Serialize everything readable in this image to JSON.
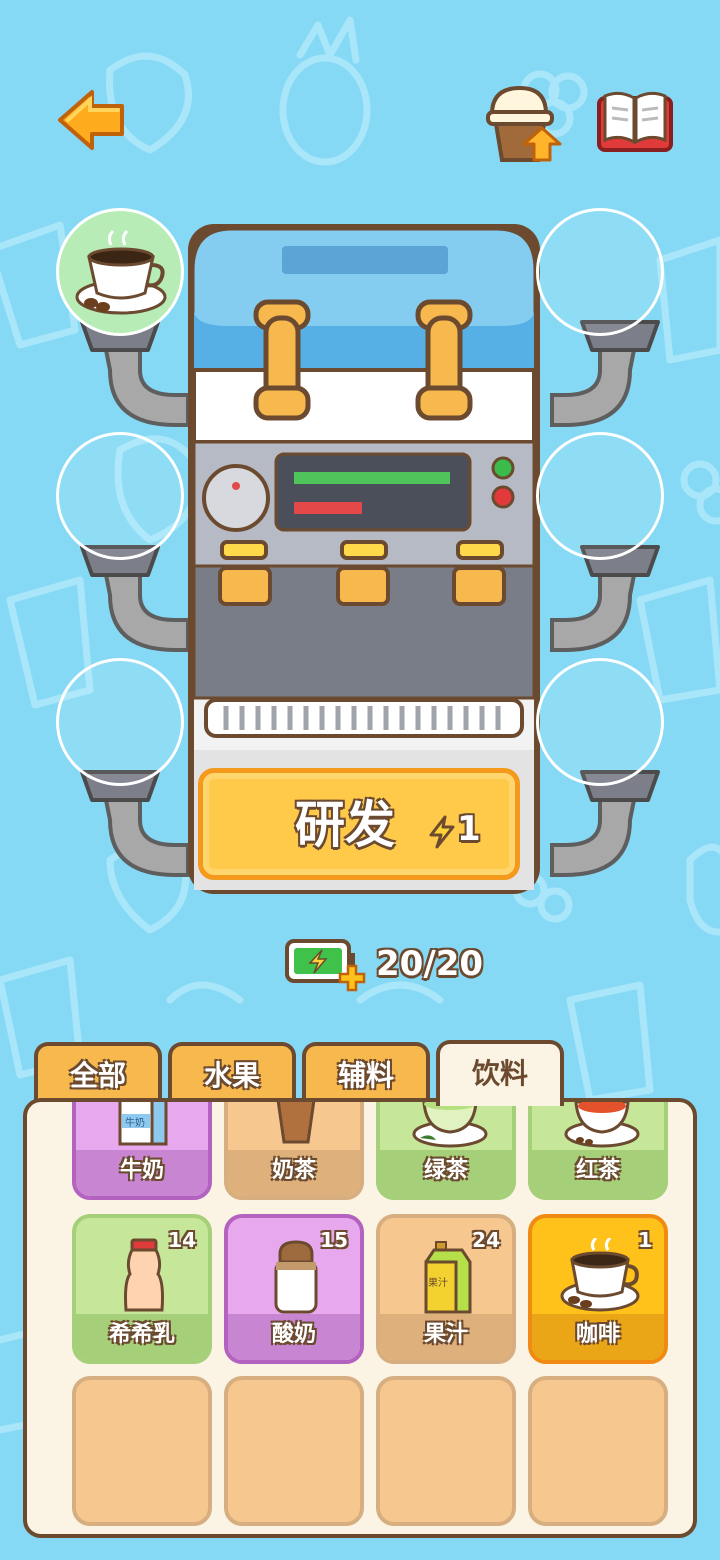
{
  "energy": {
    "value": "20/20"
  },
  "machine": {
    "button_label": "研发",
    "cost": "1"
  },
  "tabs": [
    {
      "label": "全部",
      "active": false
    },
    {
      "label": "水果",
      "active": false
    },
    {
      "label": "辅料",
      "active": false
    },
    {
      "label": "饮料",
      "active": true
    }
  ],
  "items_row1": [
    {
      "name": "牛奶",
      "color": "purple"
    },
    {
      "name": "奶茶",
      "color": "tan"
    },
    {
      "name": "绿茶",
      "color": "green"
    },
    {
      "name": "红茶",
      "color": "green"
    }
  ],
  "items_row2": [
    {
      "name": "希希乳",
      "count": "14",
      "color": "green"
    },
    {
      "name": "酸奶",
      "count": "15",
      "color": "purple"
    },
    {
      "name": "果汁",
      "count": "24",
      "color": "tan"
    },
    {
      "name": "咖啡",
      "count": "1",
      "color": "orange",
      "selected": true
    }
  ],
  "icons": {
    "back": "back-arrow-icon",
    "upgrade": "cup-upgrade-icon",
    "book": "recipe-book-icon",
    "battery": "battery-plus-icon",
    "lightning": "lightning-icon"
  },
  "colors": {
    "background": "#86d9f5",
    "outline": "#6b4a2f",
    "button": "#ffc94a"
  }
}
